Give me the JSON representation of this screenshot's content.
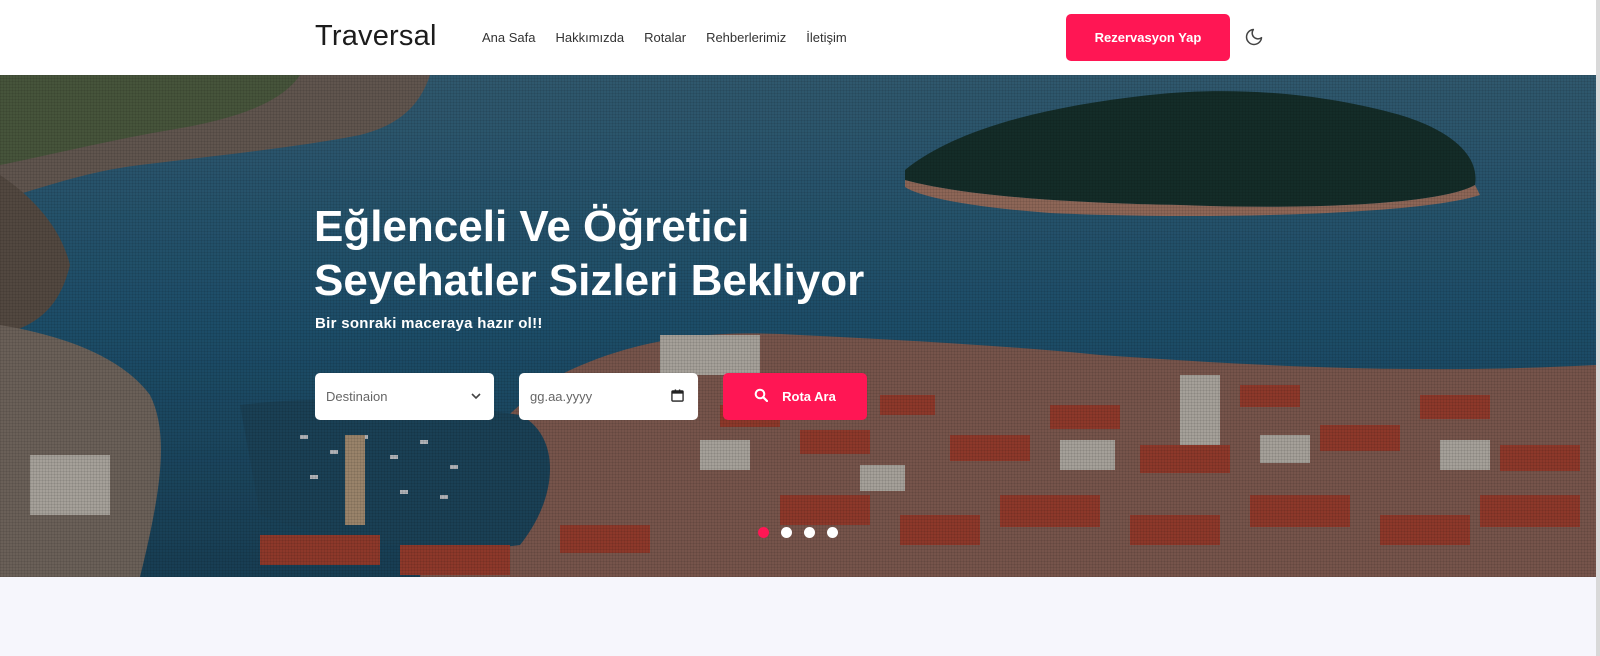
{
  "header": {
    "brand": "Traversal",
    "nav": [
      "Ana Safa",
      "Hakkımızda",
      "Rotalar",
      "Rehberlerimiz",
      "İletişim"
    ],
    "cta_label": "Rezervasyon Yap",
    "theme_icon": "moon-icon"
  },
  "hero": {
    "title_line1": "Eğlenceli Ve Öğretici",
    "title_line2": "Seyehatler Sizleri Bekliyor",
    "subtitle": "Bir sonraki maceraya hazır ol!!",
    "destination_placeholder": "Destinaion",
    "date_placeholder": "gg.aa.yyyy",
    "search_label": "Rota Ara",
    "slides_total": 4,
    "active_slide": 1
  },
  "colors": {
    "accent": "#ff1654",
    "sea": "#2c6f8c",
    "page_bg": "#f6f6fc"
  }
}
